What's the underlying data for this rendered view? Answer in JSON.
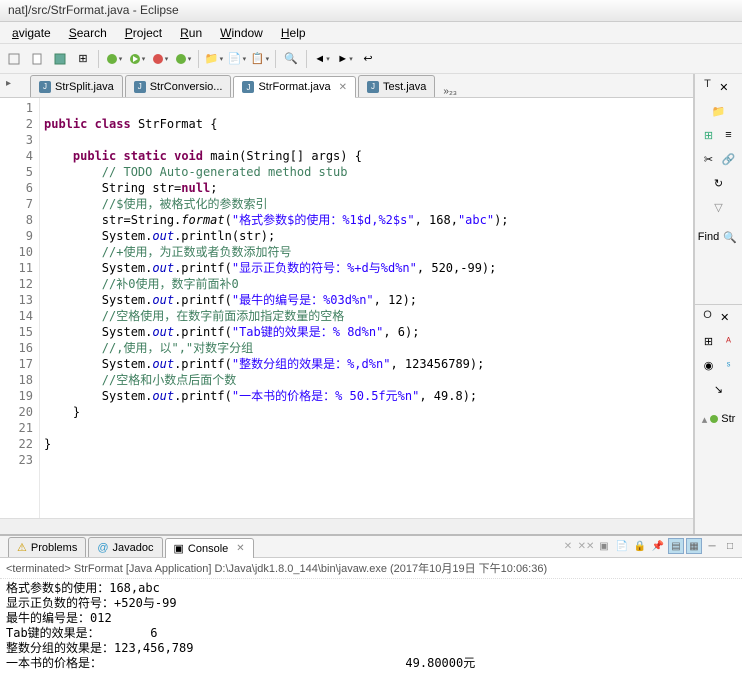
{
  "title": "nat]/src/StrFormat.java - Eclipse",
  "menus": [
    "avigate",
    "Search",
    "Project",
    "Run",
    "Window",
    "Help"
  ],
  "tabs": [
    {
      "label": "StrSplit.java",
      "active": false
    },
    {
      "label": "StrConversio...",
      "active": false
    },
    {
      "label": "StrFormat.java",
      "active": true
    },
    {
      "label": "Test.java",
      "active": false
    }
  ],
  "tab_overflow": "»₂₃",
  "code": {
    "lines": [
      {
        "n": 1,
        "html": ""
      },
      {
        "n": 2,
        "html": "<span class='kw'>public</span> <span class='kw'>class</span> StrFormat {"
      },
      {
        "n": 3,
        "html": ""
      },
      {
        "n": 4,
        "html": "    <span class='kw'>public</span> <span class='kw'>static</span> <span class='kw'>void</span> main(String[] args) {",
        "fold": true
      },
      {
        "n": 5,
        "html": "        <span class='cm'>// TODO Auto-generated method stub</span>",
        "todo": true
      },
      {
        "n": 6,
        "html": "        String str=<span class='kw'>null</span>;"
      },
      {
        "n": 7,
        "html": "        <span class='cm'>//$使用，被格式化的参数索引</span>"
      },
      {
        "n": 8,
        "html": "        str=String.<span class='mtd'>format</span>(<span class='str'>\"格式参数$的使用：%1$d,%2$s\"</span>, 168,<span class='str'>\"abc\"</span>);"
      },
      {
        "n": 9,
        "html": "        System.<span class='fld'>out</span>.println(str);"
      },
      {
        "n": 10,
        "html": "        <span class='cm'>//+使用，为正数或者负数添加符号</span>"
      },
      {
        "n": 11,
        "html": "        System.<span class='fld'>out</span>.printf(<span class='str'>\"显示正负数的符号：%+d与%d%n\"</span>, 520,-99);"
      },
      {
        "n": 12,
        "html": "        <span class='cm'>//补0使用，数字前面补0</span>"
      },
      {
        "n": 13,
        "html": "        System.<span class='fld'>out</span>.printf(<span class='str'>\"最牛的编号是：%03d%n\"</span>, 12);"
      },
      {
        "n": 14,
        "html": "        <span class='cm'>//空格使用，在数字前面添加指定数量的空格</span>"
      },
      {
        "n": 15,
        "html": "        System.<span class='fld'>out</span>.printf(<span class='str'>\"Tab键的效果是：% 8d%n\"</span>, 6);"
      },
      {
        "n": 16,
        "html": "        <span class='cm'>//,使用，以\",\"对数字分组</span>"
      },
      {
        "n": 17,
        "html": "        System.<span class='fld'>out</span>.printf(<span class='str'>\"整数分组的效果是：%,d%n\"</span>, 123456789);"
      },
      {
        "n": 18,
        "html": "        <span class='cm'>//空格和小数点后面个数</span>"
      },
      {
        "n": 19,
        "html": "        System.<span class='fld'>out</span>.printf(<span class='str'>\"一本书的价格是：% 50.5f元%n\"</span>, 49.8);"
      },
      {
        "n": 20,
        "html": "    }"
      },
      {
        "n": 21,
        "html": ""
      },
      {
        "n": 22,
        "html": "}"
      },
      {
        "n": 23,
        "html": ""
      }
    ]
  },
  "right": {
    "t_label": "T",
    "find": "Find",
    "outline_label": "O",
    "tree_item": "Str"
  },
  "bottom": {
    "tabs": [
      {
        "label": "Problems",
        "icon": "⚠"
      },
      {
        "label": "Javadoc",
        "icon": "@"
      },
      {
        "label": "Console",
        "icon": "▣",
        "active": true
      }
    ],
    "header": "<terminated> StrFormat [Java Application] D:\\Java\\jdk1.8.0_144\\bin\\javaw.exe (2017年10月19日 下午10:06:36)",
    "output": "格式参数$的使用：168,abc\n显示正负数的符号：+520与-99\n最牛的编号是：012\nTab键的效果是：       6\n整数分组的效果是：123,456,789\n一本书的价格是：                                          49.80000元"
  }
}
